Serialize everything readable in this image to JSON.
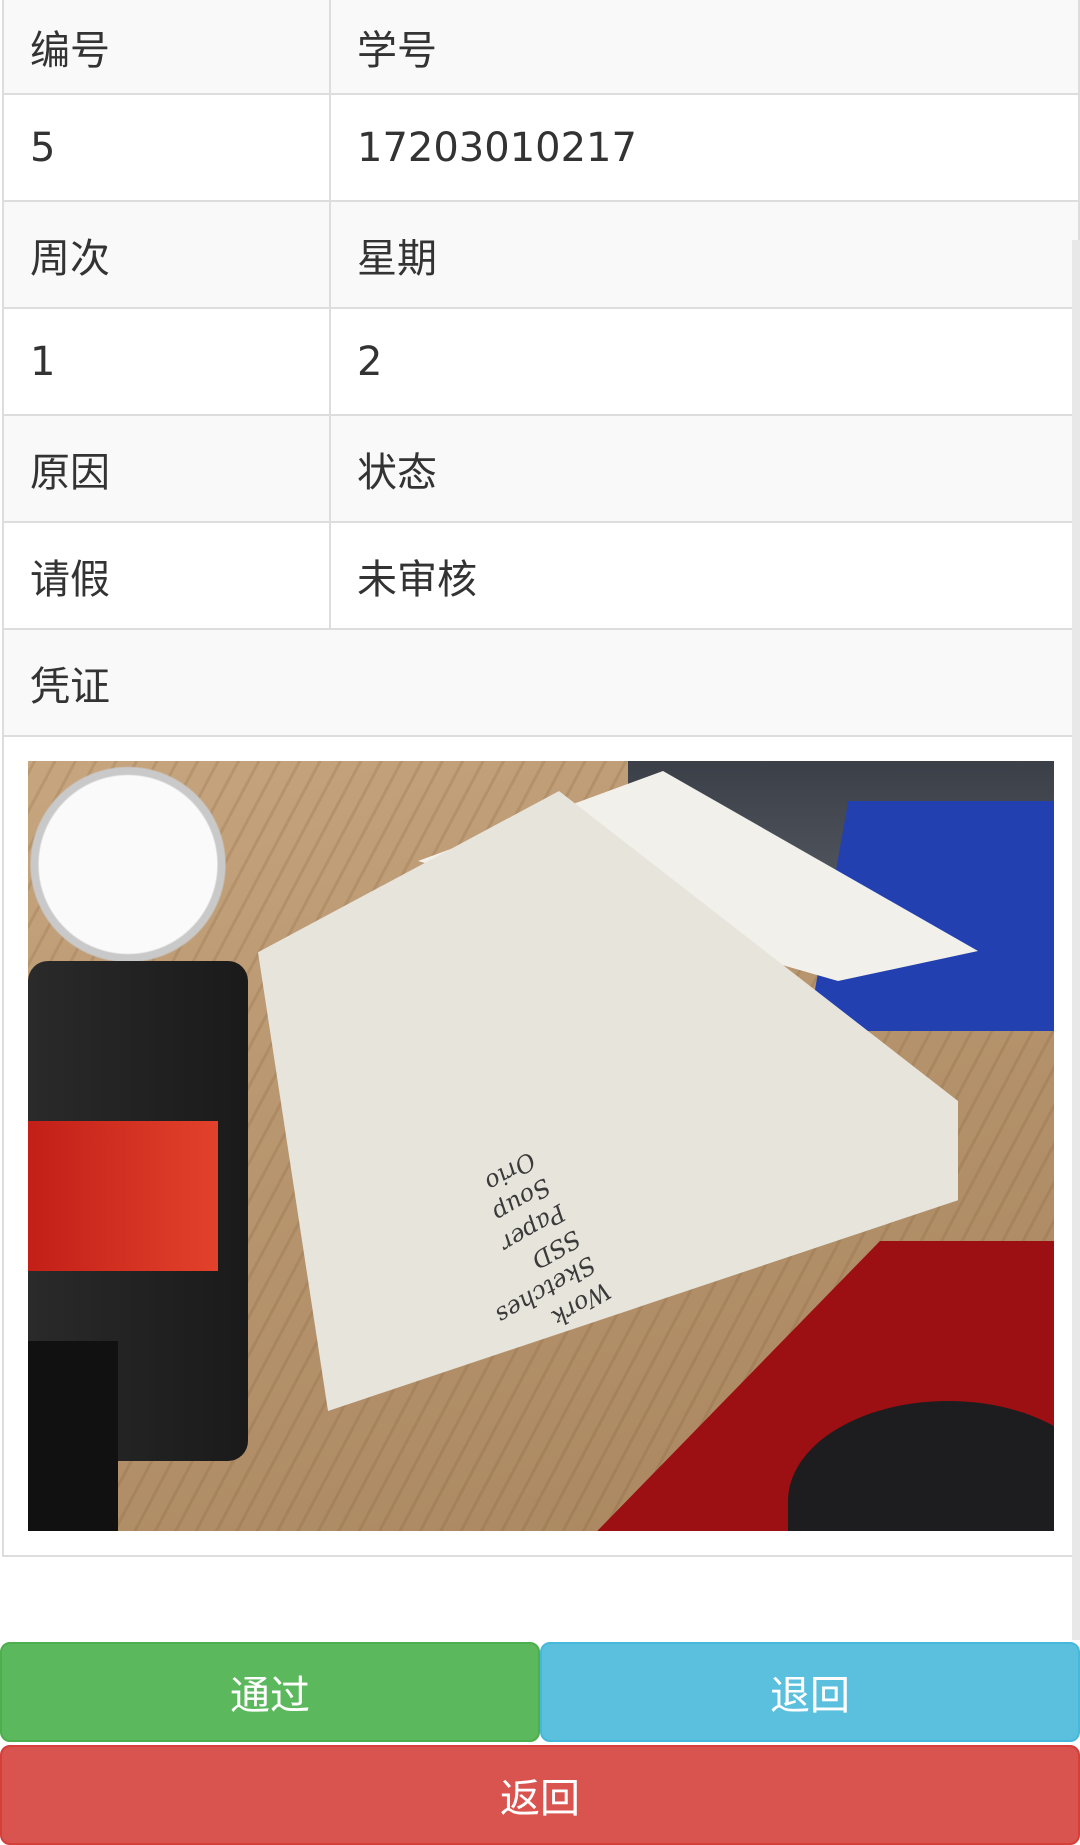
{
  "table": {
    "row1": {
      "left": "编号",
      "right": "学号"
    },
    "row2": {
      "left": "5",
      "right": "17203010217"
    },
    "row3": {
      "left": "周次",
      "right": "星期"
    },
    "row4": {
      "left": "1",
      "right": "2"
    },
    "row5": {
      "left": "原因",
      "right": "状态"
    },
    "row6": {
      "left": "请假",
      "right": "未审核"
    },
    "row7": {
      "label": "凭证"
    }
  },
  "photo": {
    "handwriting": "Work\nSketches\nSSD\nPaper\nSoup\nOrio"
  },
  "buttons": {
    "pass_label": "通过",
    "reject_label": "退回",
    "back_label": "返回"
  },
  "colors": {
    "pass": "#5cb85c",
    "reject": "#5bc0de",
    "back": "#d9534f"
  }
}
